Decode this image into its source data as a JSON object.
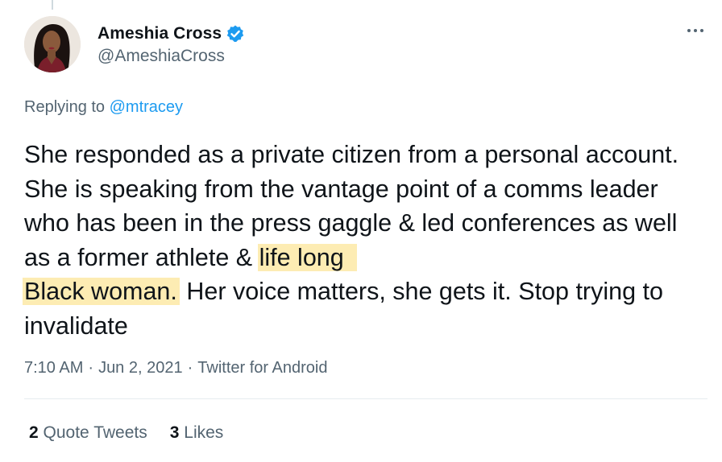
{
  "author": {
    "display_name": "Ameshia Cross",
    "handle": "@AmeshiaCross",
    "verified": true,
    "avatar_icon": "profile-photo"
  },
  "more_icon": "more-horizontal-icon",
  "reply": {
    "prefix": "Replying to ",
    "mention": "@mtracey"
  },
  "tweet": {
    "text_part1": "She responded as a private citizen from a personal account. She is speaking from the vantage point of a comms leader who has been in the press gaggle & led conferences as well as a former athlete & ",
    "highlight_1": "life long",
    "highlight_2": "Black woman.",
    "text_part2": " Her voice matters, she gets it. Stop trying to invalidate"
  },
  "meta": {
    "time": "7:10 AM",
    "date": "Jun 2, 2021",
    "source": "Twitter for Android",
    "separator": "·"
  },
  "stats": {
    "quote_count": "2",
    "quote_label": "Quote Tweets",
    "like_count": "3",
    "like_label": "Likes"
  },
  "colors": {
    "accent": "#1d9bf0",
    "highlight": "#fdecb3",
    "secondary_text": "#536471",
    "primary_text": "#0f1419"
  }
}
